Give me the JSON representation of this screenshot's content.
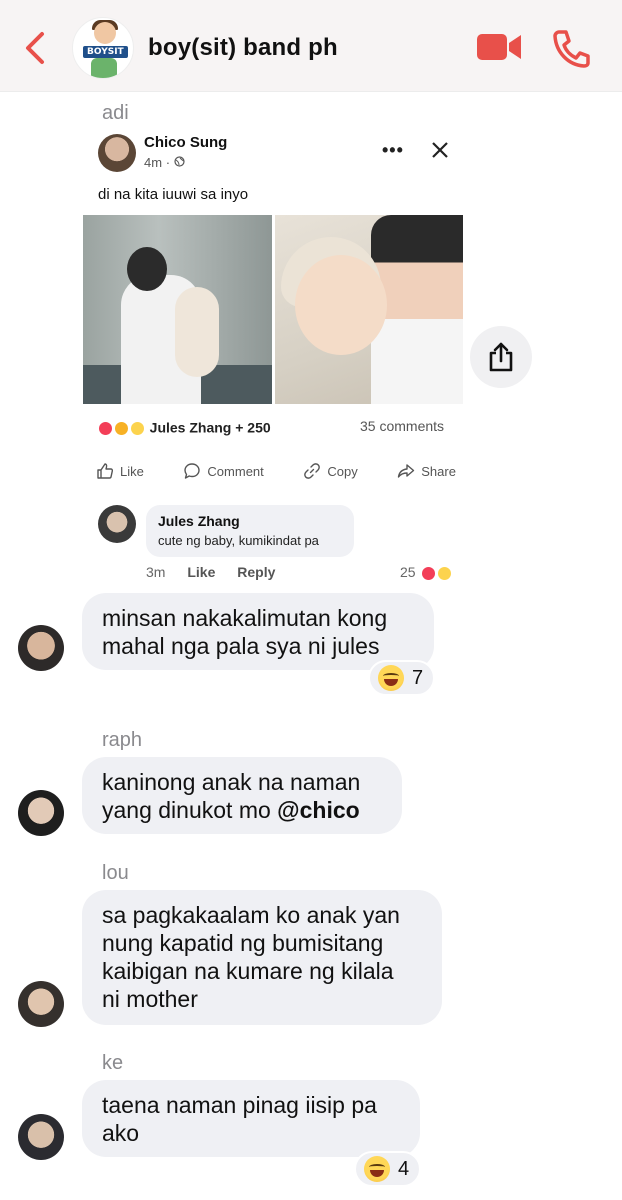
{
  "header": {
    "title": "boy(sit) band ph",
    "avatar_badge": "BOYSIT"
  },
  "messages": [
    {
      "sender": "adi",
      "shared_post": {
        "author": "Chico Sung",
        "time": "4m",
        "caption": "di na kita iuuwi sa inyo",
        "reactions_text": "Jules Zhang + 250",
        "comments_count": "35 comments",
        "actions": [
          "Like",
          "Comment",
          "Copy",
          "Share"
        ],
        "top_comment": {
          "author": "Jules Zhang",
          "text": "cute ng baby, kumikindat pa",
          "time": "3m",
          "like_label": "Like",
          "reply_label": "Reply",
          "likes": "25"
        }
      }
    },
    {
      "sender": "adi",
      "lines": [
        "minsan nakakalimutan kong",
        "mahal nga pala sya ni jules"
      ],
      "reaction_count": "7"
    },
    {
      "sender": "raph",
      "lines": [
        "kaninong anak na naman",
        "yang dinukot mo "
      ],
      "mention": "@chico"
    },
    {
      "sender": "lou",
      "lines": [
        "sa pagkakaalam ko anak yan",
        "nung kapatid ng bumisitang",
        "kaibigan na kumare ng kilala",
        "ni mother"
      ]
    },
    {
      "sender": "ke",
      "lines": [
        "taena naman pinag iisip pa",
        "ako"
      ],
      "reaction_count": "4"
    }
  ],
  "colors": {
    "accent": "#e8504a",
    "bubble": "#eff0f4",
    "header_bg": "#f7f4f4"
  }
}
